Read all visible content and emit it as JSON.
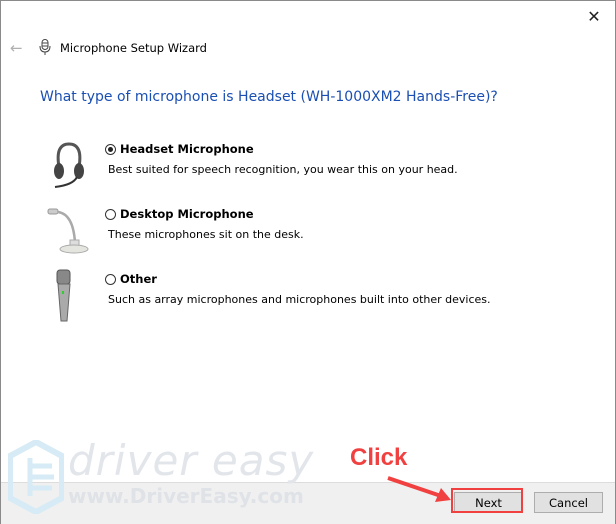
{
  "window": {
    "title": "Microphone Setup Wizard",
    "close_icon": "close-icon",
    "back_icon": "arrow-left-icon"
  },
  "question": "What type of microphone is Headset (WH-1000XM2 Hands-Free)?",
  "options": [
    {
      "label": "Headset Microphone",
      "description": "Best suited for speech recognition, you wear this on your head.",
      "selected": true,
      "icon": "headset-icon"
    },
    {
      "label": "Desktop Microphone",
      "description": "These microphones sit on the desk.",
      "selected": false,
      "icon": "desktop-microphone-icon"
    },
    {
      "label": "Other",
      "description": "Such as array microphones and microphones built into other devices.",
      "selected": false,
      "icon": "handheld-microphone-icon"
    }
  ],
  "buttons": {
    "next": "Next",
    "cancel": "Cancel"
  },
  "annotation": {
    "text": "Click",
    "color": "#f0403f"
  },
  "watermark": {
    "brand": "driver easy",
    "url": "www.DriverEasy.com"
  },
  "colors": {
    "question": "#1a4fb3",
    "footer": "#f0f0f0"
  }
}
